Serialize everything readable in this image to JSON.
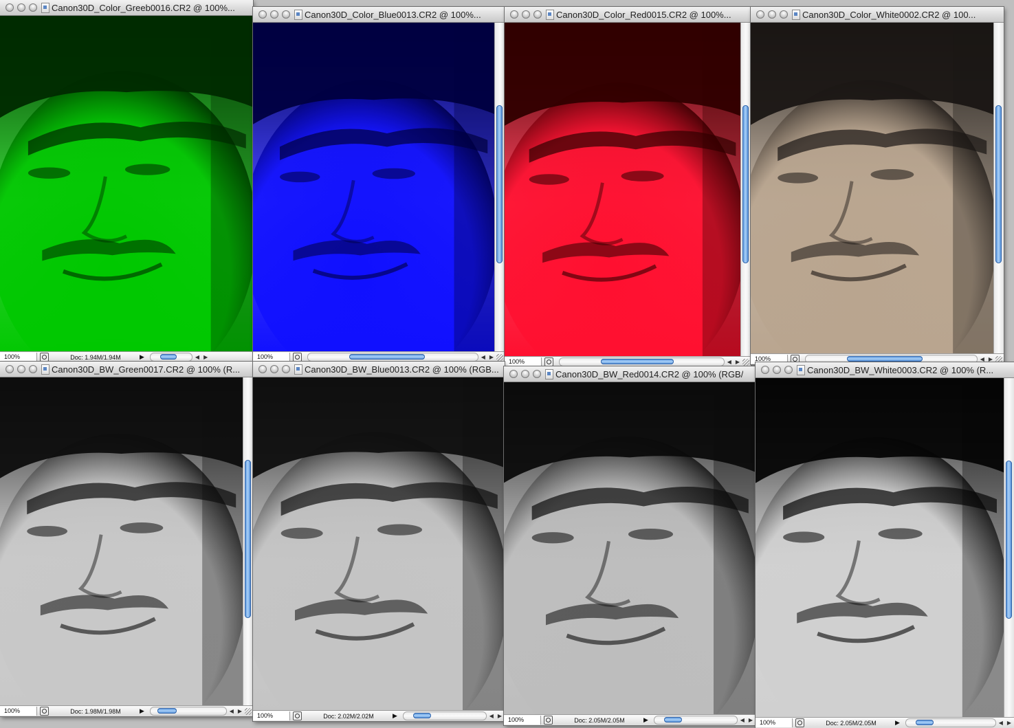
{
  "windows": [
    {
      "id": "color-green",
      "title": "Canon30D_Color_Greeb0016.CR2 @ 100%...",
      "zoom": "100%",
      "doc": "Doc: 1.94M/1.94M",
      "tint": "#00c800",
      "shadow": "#002a00",
      "bw": false
    },
    {
      "id": "color-blue",
      "title": "Canon30D_Color_Blue0013.CR2 @ 100%...",
      "zoom": "100%",
      "doc": "",
      "tint": "#1010ff",
      "shadow": "#000040",
      "bw": false
    },
    {
      "id": "color-red",
      "title": "Canon30D_Color_Red0015.CR2 @ 100%...",
      "zoom": "100%",
      "doc": "",
      "tint": "#ff1030",
      "shadow": "#300000",
      "bw": false
    },
    {
      "id": "color-white",
      "title": "Canon30D_Color_White0002.CR2 @ 100...",
      "zoom": "100%",
      "doc": "",
      "tint": "#b9a58f",
      "shadow": "#1a1614",
      "bw": false
    },
    {
      "id": "bw-green",
      "title": "Canon30D_BW_Green0017.CR2 @ 100% (R...",
      "zoom": "100%",
      "doc": "Doc: 1.98M/1.98M",
      "tint": "#c8c8c8",
      "shadow": "#0d0d0d",
      "bw": true
    },
    {
      "id": "bw-blue",
      "title": "Canon30D_BW_Blue0013.CR2 @ 100% (RGB...",
      "zoom": "100%",
      "doc": "Doc: 2.02M/2.02M",
      "tint": "#c4c4c4",
      "shadow": "#0f0f0f",
      "bw": true
    },
    {
      "id": "bw-red",
      "title": "Canon30D_BW_Red0014.CR2 @ 100% (RGB/",
      "zoom": "100%",
      "doc": "Doc: 2.05M/2.05M",
      "tint": "#bdbdbd",
      "shadow": "#0b0b0b",
      "bw": true
    },
    {
      "id": "bw-white",
      "title": "Canon30D_BW_White0003.CR2 @ 100% (R...",
      "zoom": "100%",
      "doc": "Doc: 2.05M/2.05M",
      "tint": "#d0d0d0",
      "shadow": "#050505",
      "bw": true
    }
  ],
  "icons": {
    "close": "close-button-icon",
    "minimize": "minimize-button-icon",
    "zoom": "zoom-button-icon",
    "document": "document-proxy-icon",
    "navigator": "navigator-icon"
  }
}
